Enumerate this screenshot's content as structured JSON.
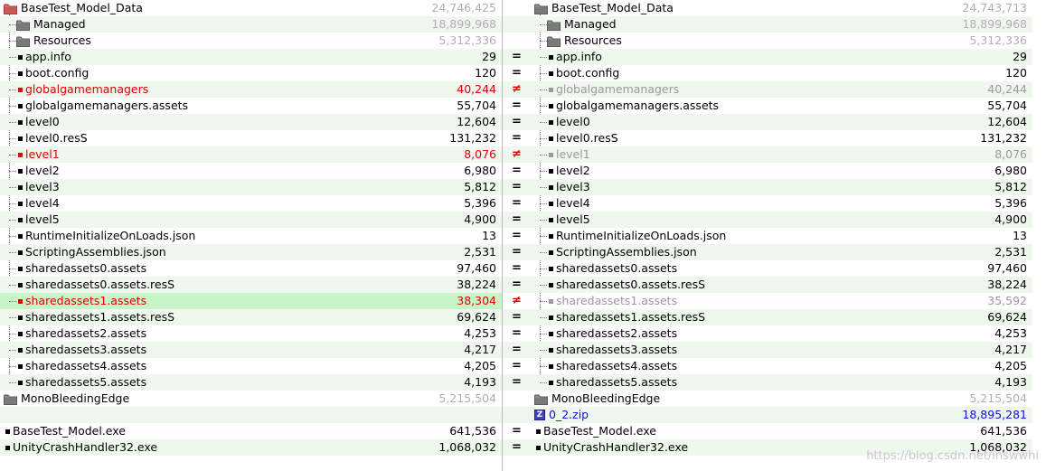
{
  "left": {
    "rows": [
      {
        "type": "folder",
        "open": true,
        "level": 0,
        "name": "BaseTest_Model_Data",
        "size": "24,746,425",
        "dim": true,
        "variant": "red"
      },
      {
        "type": "folder",
        "level": 1,
        "name": "Managed",
        "size": "18,899,968",
        "dim": true
      },
      {
        "type": "folder",
        "level": 1,
        "name": "Resources",
        "size": "5,312,336",
        "dim": true
      },
      {
        "type": "file",
        "level": 1,
        "name": "app.info",
        "size": "29"
      },
      {
        "type": "file",
        "level": 1,
        "name": "boot.config",
        "size": "120"
      },
      {
        "type": "file",
        "level": 1,
        "name": "globalgamemanagers",
        "size": "40,244",
        "state": "red"
      },
      {
        "type": "file",
        "level": 1,
        "name": "globalgamemanagers.assets",
        "size": "55,704"
      },
      {
        "type": "file",
        "level": 1,
        "name": "level0",
        "size": "12,604"
      },
      {
        "type": "file",
        "level": 1,
        "name": "level0.resS",
        "size": "131,232"
      },
      {
        "type": "file",
        "level": 1,
        "name": "level1",
        "size": "8,076",
        "state": "red"
      },
      {
        "type": "file",
        "level": 1,
        "name": "level2",
        "size": "6,980"
      },
      {
        "type": "file",
        "level": 1,
        "name": "level3",
        "size": "5,812"
      },
      {
        "type": "file",
        "level": 1,
        "name": "level4",
        "size": "5,396"
      },
      {
        "type": "file",
        "level": 1,
        "name": "level5",
        "size": "4,900"
      },
      {
        "type": "file",
        "level": 1,
        "name": "RuntimeInitializeOnLoads.json",
        "size": "13"
      },
      {
        "type": "file",
        "level": 1,
        "name": "ScriptingAssemblies.json",
        "size": "2,531"
      },
      {
        "type": "file",
        "level": 1,
        "name": "sharedassets0.assets",
        "size": "97,460"
      },
      {
        "type": "file",
        "level": 1,
        "name": "sharedassets0.assets.resS",
        "size": "38,224"
      },
      {
        "type": "file",
        "level": 1,
        "name": "sharedassets1.assets",
        "size": "38,304",
        "state": "red",
        "highlight": true
      },
      {
        "type": "file",
        "level": 1,
        "name": "sharedassets1.assets.resS",
        "size": "69,624"
      },
      {
        "type": "file",
        "level": 1,
        "name": "sharedassets2.assets",
        "size": "4,253"
      },
      {
        "type": "file",
        "level": 1,
        "name": "sharedassets3.assets",
        "size": "4,217"
      },
      {
        "type": "file",
        "level": 1,
        "name": "sharedassets4.assets",
        "size": "4,205"
      },
      {
        "type": "file",
        "level": 1,
        "name": "sharedassets5.assets",
        "size": "4,193"
      },
      {
        "type": "folder",
        "level": 0,
        "name": "MonoBleedingEdge",
        "size": "5,215,504",
        "dim": true
      },
      {
        "type": "empty"
      },
      {
        "type": "file",
        "level": 0,
        "name": "BaseTest_Model.exe",
        "size": "641,536"
      },
      {
        "type": "file",
        "level": 0,
        "name": "UnityCrashHandler32.exe",
        "size": "1,068,032"
      }
    ]
  },
  "gutter": [
    "",
    "",
    "",
    "=",
    "=",
    "≠",
    "=",
    "=",
    "=",
    "≠",
    "=",
    "=",
    "=",
    "=",
    "=",
    "=",
    "=",
    "=",
    "≠",
    "=",
    "=",
    "=",
    "=",
    "=",
    "",
    "",
    "=",
    "="
  ],
  "right": {
    "rows": [
      {
        "type": "folder",
        "open": true,
        "level": 0,
        "name": "BaseTest_Model_Data",
        "size": "24,743,713",
        "dim": true
      },
      {
        "type": "folder",
        "level": 1,
        "name": "Managed",
        "size": "18,899,968",
        "dim": true
      },
      {
        "type": "folder",
        "level": 1,
        "name": "Resources",
        "size": "5,312,336",
        "dim": true
      },
      {
        "type": "file",
        "level": 1,
        "name": "app.info",
        "size": "29"
      },
      {
        "type": "file",
        "level": 1,
        "name": "boot.config",
        "size": "120"
      },
      {
        "type": "file",
        "level": 1,
        "name": "globalgamemanagers",
        "size": "40,244",
        "state": "grey"
      },
      {
        "type": "file",
        "level": 1,
        "name": "globalgamemanagers.assets",
        "size": "55,704"
      },
      {
        "type": "file",
        "level": 1,
        "name": "level0",
        "size": "12,604"
      },
      {
        "type": "file",
        "level": 1,
        "name": "level0.resS",
        "size": "131,232"
      },
      {
        "type": "file",
        "level": 1,
        "name": "level1",
        "size": "8,076",
        "state": "grey"
      },
      {
        "type": "file",
        "level": 1,
        "name": "level2",
        "size": "6,980"
      },
      {
        "type": "file",
        "level": 1,
        "name": "level3",
        "size": "5,812"
      },
      {
        "type": "file",
        "level": 1,
        "name": "level4",
        "size": "5,396"
      },
      {
        "type": "file",
        "level": 1,
        "name": "level5",
        "size": "4,900"
      },
      {
        "type": "file",
        "level": 1,
        "name": "RuntimeInitializeOnLoads.json",
        "size": "13"
      },
      {
        "type": "file",
        "level": 1,
        "name": "ScriptingAssemblies.json",
        "size": "2,531"
      },
      {
        "type": "file",
        "level": 1,
        "name": "sharedassets0.assets",
        "size": "97,460"
      },
      {
        "type": "file",
        "level": 1,
        "name": "sharedassets0.assets.resS",
        "size": "38,224"
      },
      {
        "type": "file",
        "level": 1,
        "name": "sharedassets1.assets",
        "size": "35,592",
        "state": "grey"
      },
      {
        "type": "file",
        "level": 1,
        "name": "sharedassets1.assets.resS",
        "size": "69,624"
      },
      {
        "type": "file",
        "level": 1,
        "name": "sharedassets2.assets",
        "size": "4,253"
      },
      {
        "type": "file",
        "level": 1,
        "name": "sharedassets3.assets",
        "size": "4,217"
      },
      {
        "type": "file",
        "level": 1,
        "name": "sharedassets4.assets",
        "size": "4,205"
      },
      {
        "type": "file",
        "level": 1,
        "name": "sharedassets5.assets",
        "size": "4,193"
      },
      {
        "type": "folder",
        "level": 0,
        "name": "MonoBleedingEdge",
        "size": "5,215,504",
        "dim": true
      },
      {
        "type": "zip",
        "level": 0,
        "name": "0_2.zip",
        "size": "18,895,281",
        "state": "blue"
      },
      {
        "type": "file",
        "level": 0,
        "name": "BaseTest_Model.exe",
        "size": "641,536"
      },
      {
        "type": "file",
        "level": 0,
        "name": "UnityCrashHandler32.exe",
        "size": "1,068,032"
      }
    ]
  },
  "watermark": "https://blog.csdn.net/inswwhi",
  "colors": {
    "diff": "#e00000",
    "orphan": "#9a9a9a",
    "zip": "#1010d0",
    "row_alt": "#f0f7ef",
    "row_highlight": "#c8f5c8"
  }
}
